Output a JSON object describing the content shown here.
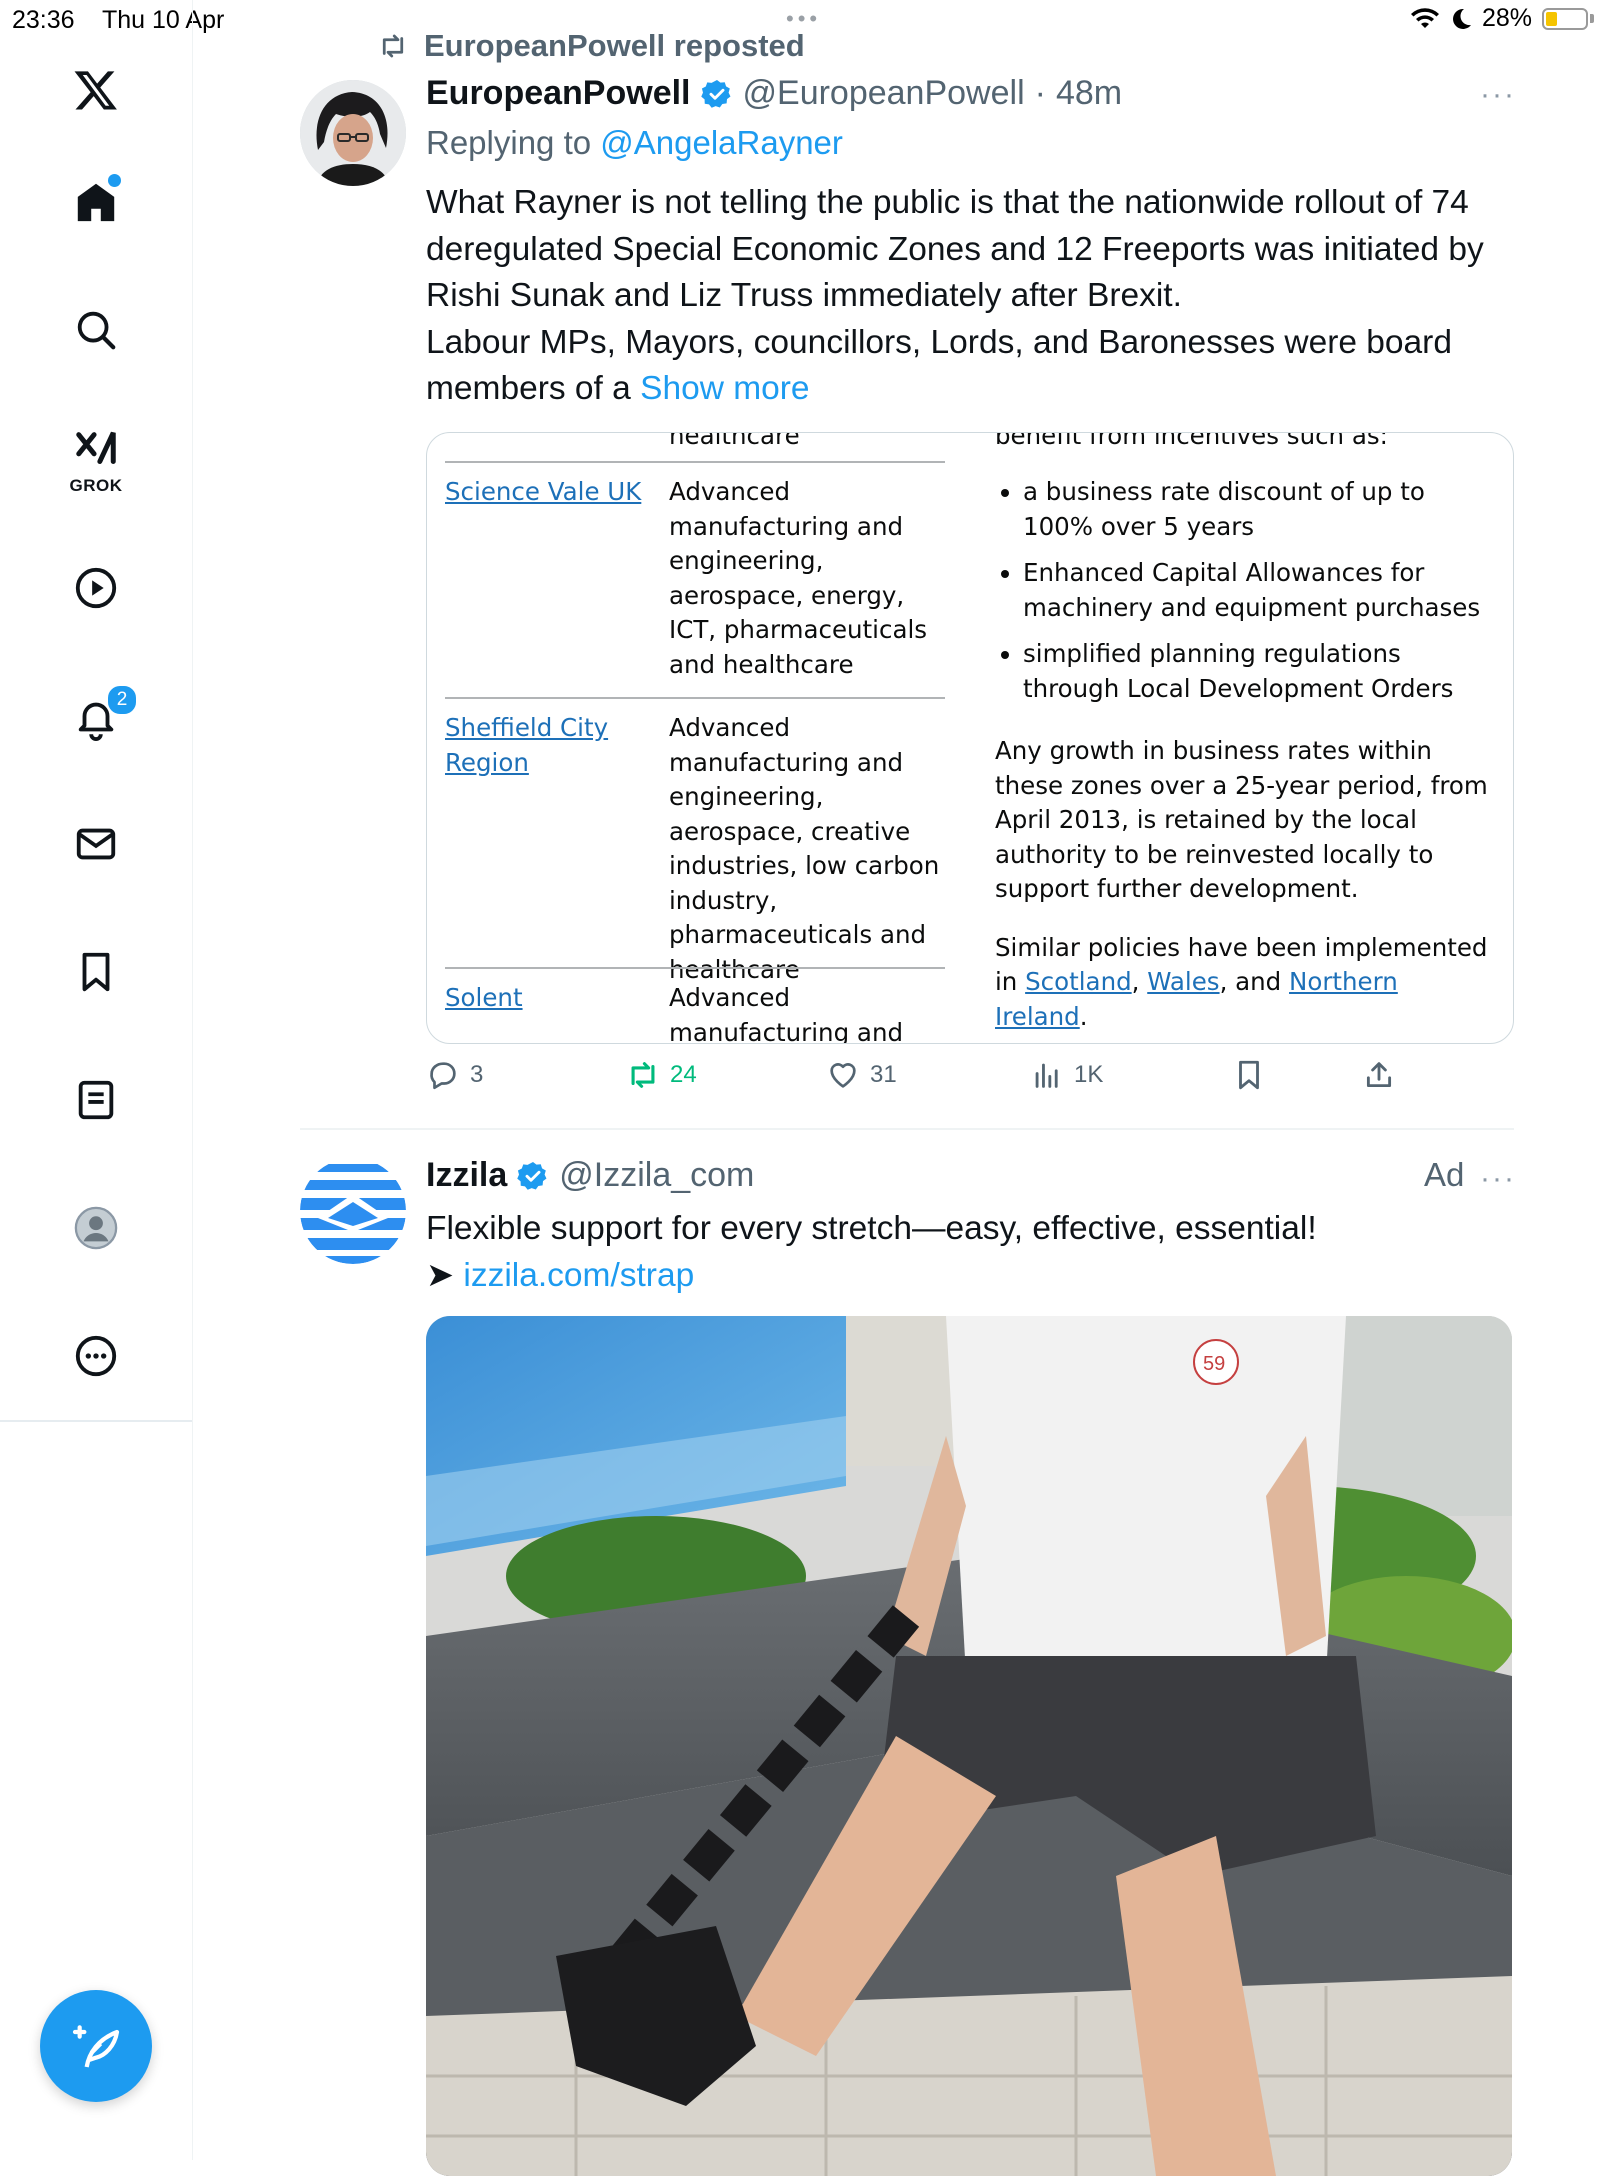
{
  "status_bar": {
    "time": "23:36",
    "date": "Thu 10 Apr",
    "battery": "28%"
  },
  "sidebar": {
    "items": [
      {
        "name": "x-logo",
        "label": "X"
      },
      {
        "name": "home",
        "label": "Home"
      },
      {
        "name": "search",
        "label": "Search"
      },
      {
        "name": "grok",
        "label": "GROK"
      },
      {
        "name": "video",
        "label": "Video"
      },
      {
        "name": "notifications",
        "label": "Notifications",
        "count": "2"
      },
      {
        "name": "messages",
        "label": "Messages"
      },
      {
        "name": "bookmarks",
        "label": "Bookmarks"
      },
      {
        "name": "lists",
        "label": "Lists"
      },
      {
        "name": "profile",
        "label": "Profile"
      },
      {
        "name": "more",
        "label": "More"
      }
    ],
    "grok_label": "GROK",
    "notifications_count": "2"
  },
  "tweet1": {
    "repost_label": "EuropeanPowell reposted",
    "name": "EuropeanPowell",
    "handle": "@EuropeanPowell",
    "dot": "·",
    "time": "48m",
    "replying_prefix": "Replying to ",
    "replying_to": "@AngelaRayner",
    "text_p1": "What Rayner is not telling the public is that the nationwide rollout of 74 deregulated Special Economic Zones and 12 Freeports was initiated by Rishi Sunak and Liz Truss immediately after Brexit.",
    "text_p2": "Labour MPs, Mayors, councillors, Lords, and Baronesses were board members of a ",
    "show_more": "Show more",
    "document": {
      "top_cut_left": "healthcare",
      "top_cut_right": "benefit from incentives such as:",
      "rows": [
        {
          "name": "Science Vale UK",
          "desc": "Advanced manufacturing and engineering, aerospace, energy, ICT, pharmaceuticals and healthcare"
        },
        {
          "name": "Sheffield City Region",
          "desc": "Advanced manufacturing and engineering, aerospace, creative industries, low carbon industry, pharmaceuticals and healthcare"
        },
        {
          "name": "Solent",
          "desc": "Advanced manufacturing and"
        }
      ],
      "bullets": [
        "a business rate discount of up to 100% over 5 years",
        "Enhanced Capital Allowances for machinery and equipment purchases",
        "simplified planning regulations through Local Development Orders"
      ],
      "para1": "Any growth in business rates within these zones over a 25-year period, from April 2013, is retained by the local authority to be reinvested locally to support further development.",
      "para2_prefix": "Similar policies have been implemented in ",
      "para2_links": [
        "Scotland",
        "Wales",
        "Northern Ireland"
      ],
      "para2_sep1": ", ",
      "para2_sep2": ", and ",
      "para2_end": "."
    },
    "actions": {
      "replies": "3",
      "reposts": "24",
      "likes": "31",
      "views": "1K"
    },
    "more_label": "···"
  },
  "ad": {
    "name": "Izzila",
    "handle": "@Izzila_com",
    "ad_label": "Ad",
    "more_label": "···",
    "text": "Flexible support for every stretch—easy, effective, essential!",
    "arrow": "➤ ",
    "link": "izzila.com/strap",
    "jersey_number": "59"
  },
  "colors": {
    "accent": "#1d9bf0",
    "repost_green": "#00ba7c",
    "text": "#0f1419",
    "muted": "#536471",
    "doc_link": "#1d70b8"
  }
}
